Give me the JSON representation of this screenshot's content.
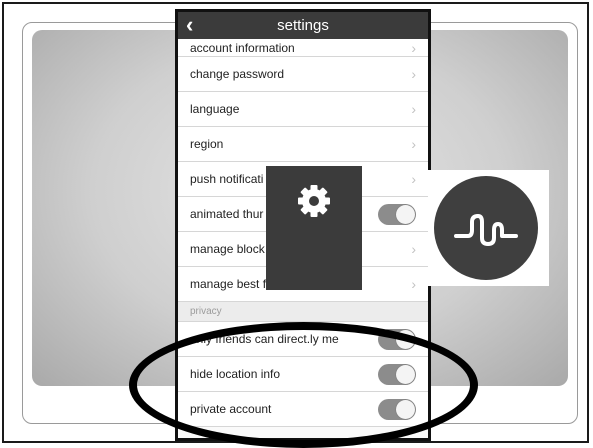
{
  "nav": {
    "title": "settings",
    "back_icon": "chevron-left-icon"
  },
  "rows": [
    {
      "label": "account information",
      "control": "chevron"
    },
    {
      "label": "change password",
      "control": "chevron"
    },
    {
      "label": "language",
      "control": "chevron"
    },
    {
      "label": "region",
      "control": "chevron"
    },
    {
      "label": "push notificati",
      "control": "chevron"
    },
    {
      "label": "animated thur",
      "control": "toggle",
      "on": true
    },
    {
      "label": "manage block",
      "control": "chevron"
    },
    {
      "label": "manage best fan forever list",
      "control": "chevron"
    }
  ],
  "privacy": {
    "header": "privacy",
    "rows": [
      {
        "label": "only friends can direct.ly me",
        "control": "toggle",
        "on": true
      },
      {
        "label": "hide location info",
        "control": "toggle",
        "on": true
      },
      {
        "label": "private account",
        "control": "toggle",
        "on": true
      }
    ]
  },
  "overlay": {
    "gear_icon": "gear-icon",
    "logo_icon": "musically-logo-icon"
  },
  "colors": {
    "nav_bg": "#3b3b3b",
    "toggle_on": "#8c8c8c",
    "annotation": "#000000"
  }
}
